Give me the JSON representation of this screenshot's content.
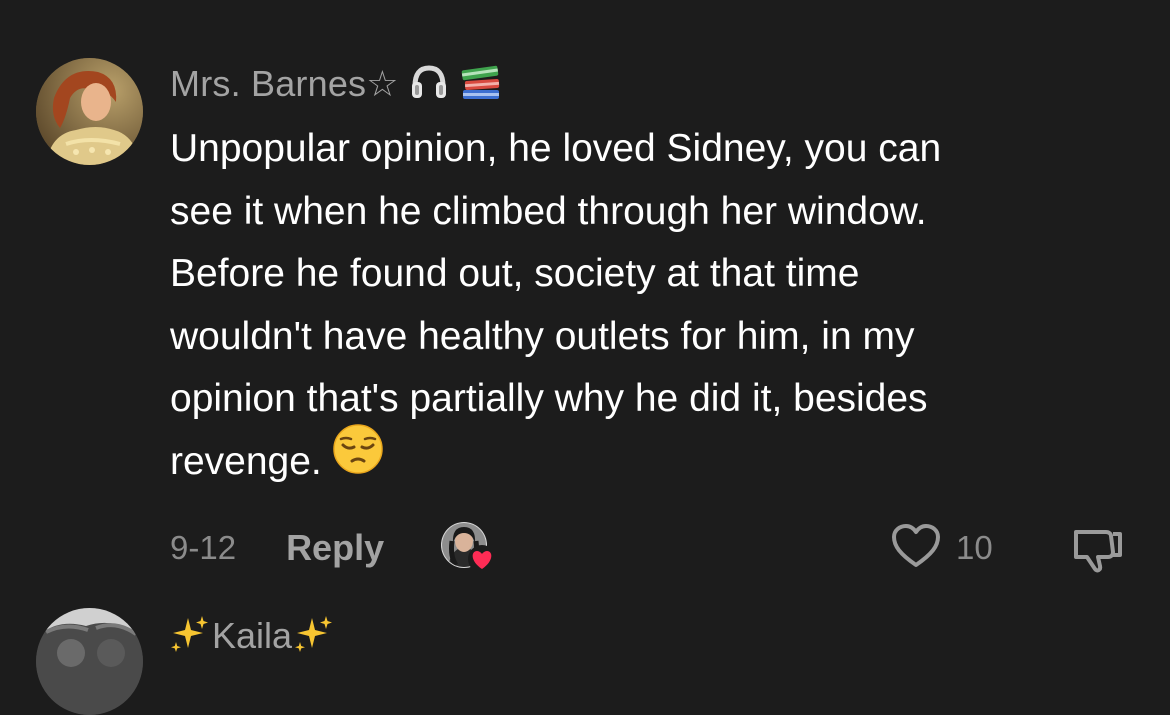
{
  "comment": {
    "username": "Mrs. Barnes☆",
    "badges": [
      "headphones-icon",
      "books-icon"
    ],
    "text_lines": [
      "Unpopular opinion, he loved Sidney, you can",
      "see it when he climbed through her window.",
      "Before he found out, society at that time",
      "wouldn't have healthy outlets for him, in my",
      "opinion that's partially why he did it, besides",
      "revenge."
    ],
    "trailing_emoji": "pensive-face-emoji",
    "date": "9-12",
    "reply_label": "Reply",
    "creator_liked": true,
    "like_count": "10",
    "colors": {
      "background": "#1c1c1c",
      "username": "#a3a3a3",
      "text": "#ffffff",
      "meta": "#8b8b8b",
      "heart": "#fe2c55"
    }
  },
  "next_comment": {
    "username": "Kaila"
  }
}
